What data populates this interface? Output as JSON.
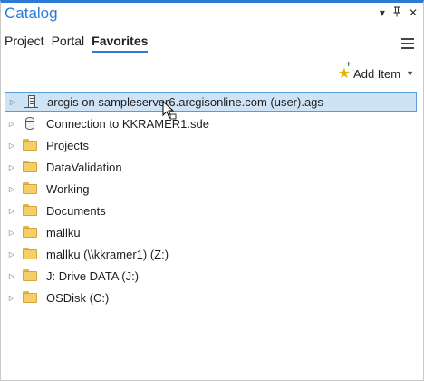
{
  "window": {
    "title": "Catalog",
    "dropdown_glyph": "▾",
    "pin_glyph": "⊥",
    "close_glyph": "✕"
  },
  "tabs": [
    {
      "label": "Project",
      "active": false
    },
    {
      "label": "Portal",
      "active": false
    },
    {
      "label": "Favorites",
      "active": true
    }
  ],
  "toolbar": {
    "add_item_label": "Add Item",
    "add_item_icon": "star-add-icon",
    "menu_icon": "hamburger-menu-icon"
  },
  "tree": {
    "items": [
      {
        "label": "arcgis on sampleserver6.arcgisonline.com (user).ags",
        "icon": "server-icon",
        "selected": true
      },
      {
        "label": "Connection to KKRAMER1.sde",
        "icon": "database-icon",
        "selected": false
      },
      {
        "label": "Projects",
        "icon": "folder-icon",
        "selected": false
      },
      {
        "label": "DataValidation",
        "icon": "folder-icon",
        "selected": false
      },
      {
        "label": "Working",
        "icon": "folder-icon",
        "selected": false
      },
      {
        "label": "Documents",
        "icon": "folder-icon",
        "selected": false
      },
      {
        "label": "mallku",
        "icon": "folder-icon",
        "selected": false
      },
      {
        "label": "mallku (\\\\kkramer1) (Z:)",
        "icon": "folder-icon",
        "selected": false
      },
      {
        "label": "J: Drive DATA (J:)",
        "icon": "folder-icon",
        "selected": false
      },
      {
        "label": "OSDisk (C:)",
        "icon": "folder-icon",
        "selected": false
      }
    ]
  },
  "colors": {
    "accent": "#2b7bd6",
    "selection_bg": "#cfe3f7",
    "selection_border": "#5a9bd8",
    "folder": "#f4cf67"
  }
}
